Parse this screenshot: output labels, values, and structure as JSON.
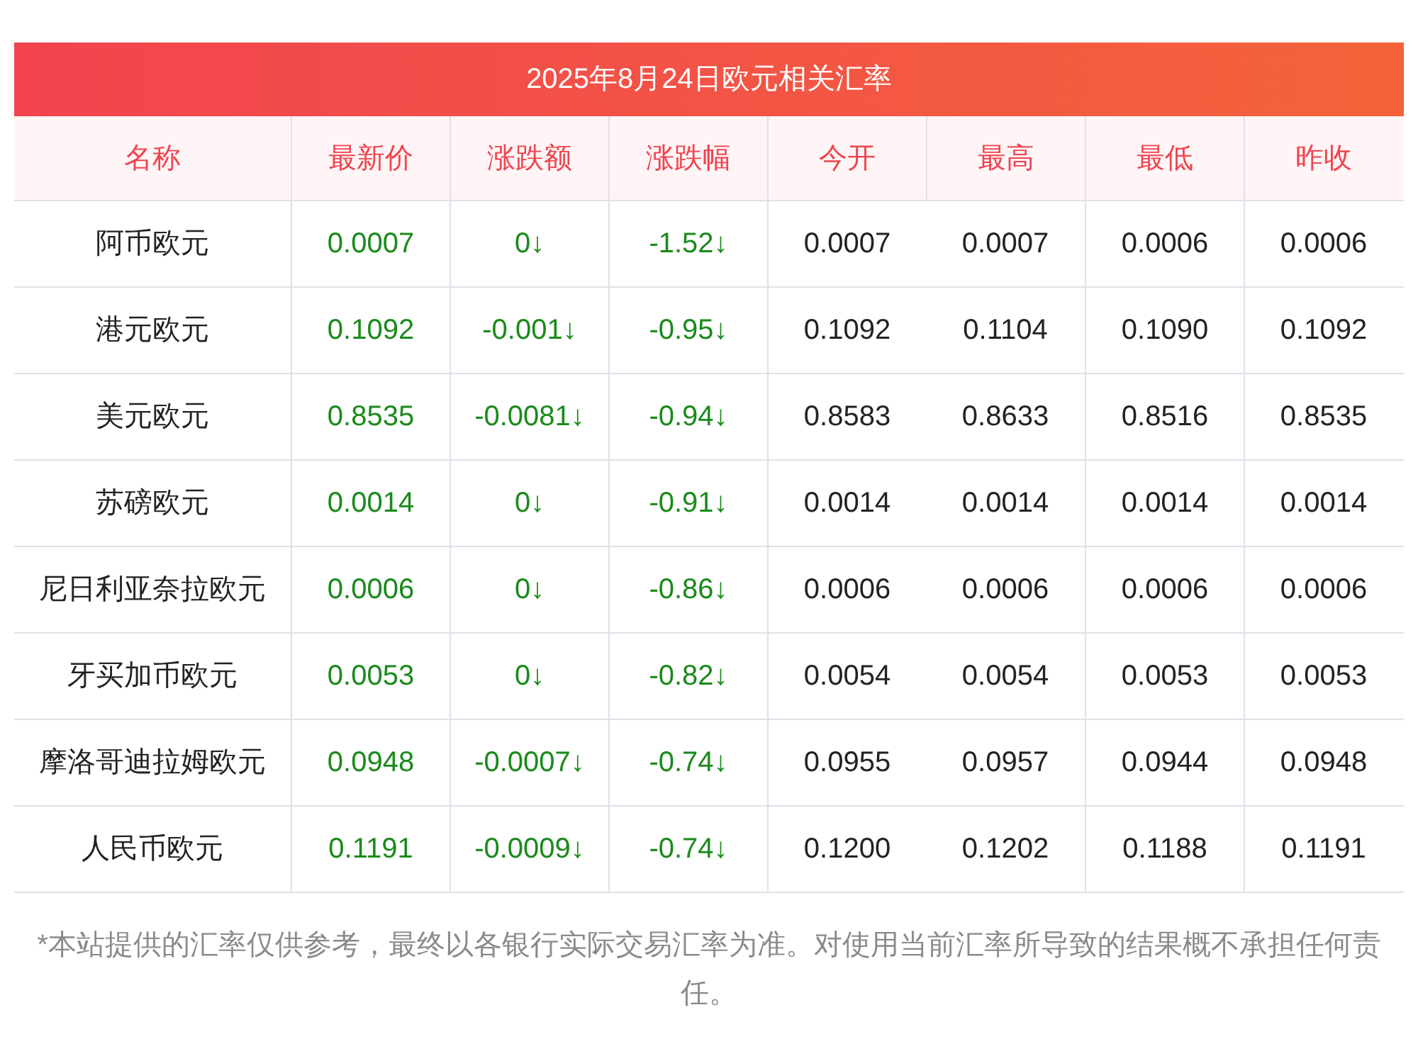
{
  "title": "2025年8月24日欧元相关汇率",
  "table": {
    "columns": [
      {
        "label": "名称",
        "kind": "name"
      },
      {
        "label": "最新价",
        "kind": "change"
      },
      {
        "label": "涨跌额",
        "kind": "change"
      },
      {
        "label": "涨跌幅",
        "kind": "change"
      },
      {
        "label": "今开",
        "kind": "plain"
      },
      {
        "label": "最高",
        "kind": "plain"
      },
      {
        "label": "最低",
        "kind": "plain"
      },
      {
        "label": "昨收",
        "kind": "plain"
      }
    ],
    "rows": [
      [
        "阿币欧元",
        "0.0007",
        "0↓",
        "-1.52↓",
        "0.0007",
        "0.0007",
        "0.0006",
        "0.0006"
      ],
      [
        "港元欧元",
        "0.1092",
        "-0.001↓",
        "-0.95↓",
        "0.1092",
        "0.1104",
        "0.1090",
        "0.1092"
      ],
      [
        "美元欧元",
        "0.8535",
        "-0.0081↓",
        "-0.94↓",
        "0.8583",
        "0.8633",
        "0.8516",
        "0.8535"
      ],
      [
        "苏磅欧元",
        "0.0014",
        "0↓",
        "-0.91↓",
        "0.0014",
        "0.0014",
        "0.0014",
        "0.0014"
      ],
      [
        "尼日利亚奈拉欧元",
        "0.0006",
        "0↓",
        "-0.86↓",
        "0.0006",
        "0.0006",
        "0.0006",
        "0.0006"
      ],
      [
        "牙买加币欧元",
        "0.0053",
        "0↓",
        "-0.82↓",
        "0.0054",
        "0.0054",
        "0.0053",
        "0.0053"
      ],
      [
        "摩洛哥迪拉姆欧元",
        "0.0948",
        "-0.0007↓",
        "-0.74↓",
        "0.0955",
        "0.0957",
        "0.0944",
        "0.0948"
      ],
      [
        "人民币欧元",
        "0.1191",
        "-0.0009↓",
        "-0.74↓",
        "0.1200",
        "0.1202",
        "0.1188",
        "0.1191"
      ]
    ]
  },
  "footnote": "*本站提供的汇率仅供参考，最终以各银行实际交易汇率为准。对使用当前汇率所导致的结果概不承担任何责任。"
}
